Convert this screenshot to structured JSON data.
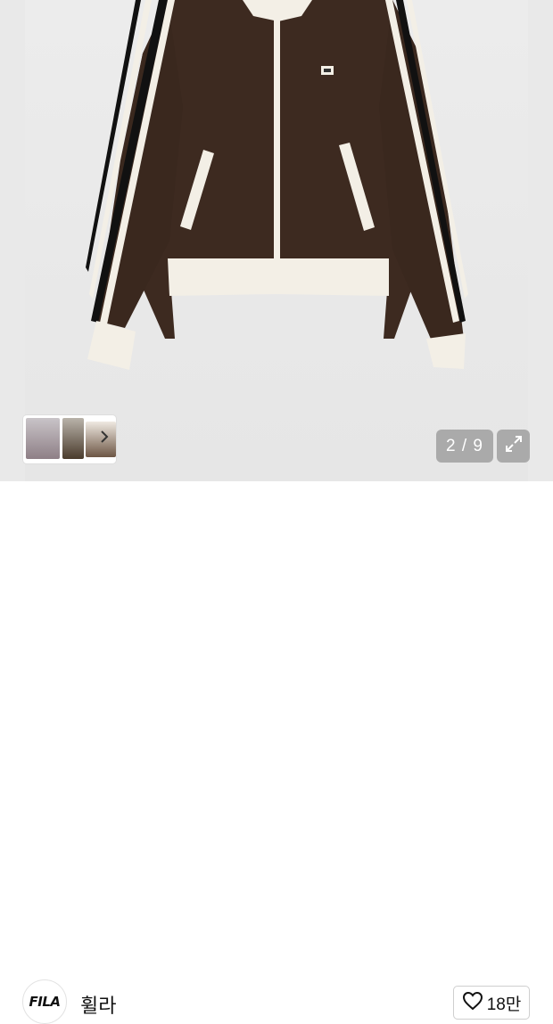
{
  "gallery": {
    "current_page": 2,
    "total_pages": 9,
    "counter_text": "2 / 9",
    "product_image": "brown-track-jacket",
    "thumbnail_next_icon": "chevron-right-icon",
    "expand_icon": "expand-icon"
  },
  "brand": {
    "logo_text": "FILA",
    "name": "휠라"
  },
  "like": {
    "icon": "heart-outline-icon",
    "count": "18만"
  },
  "colors": {
    "jacket": "#3d2a20",
    "trim": "#f3efe6",
    "stripe_dark": "#161616",
    "overlay": "#787878"
  }
}
